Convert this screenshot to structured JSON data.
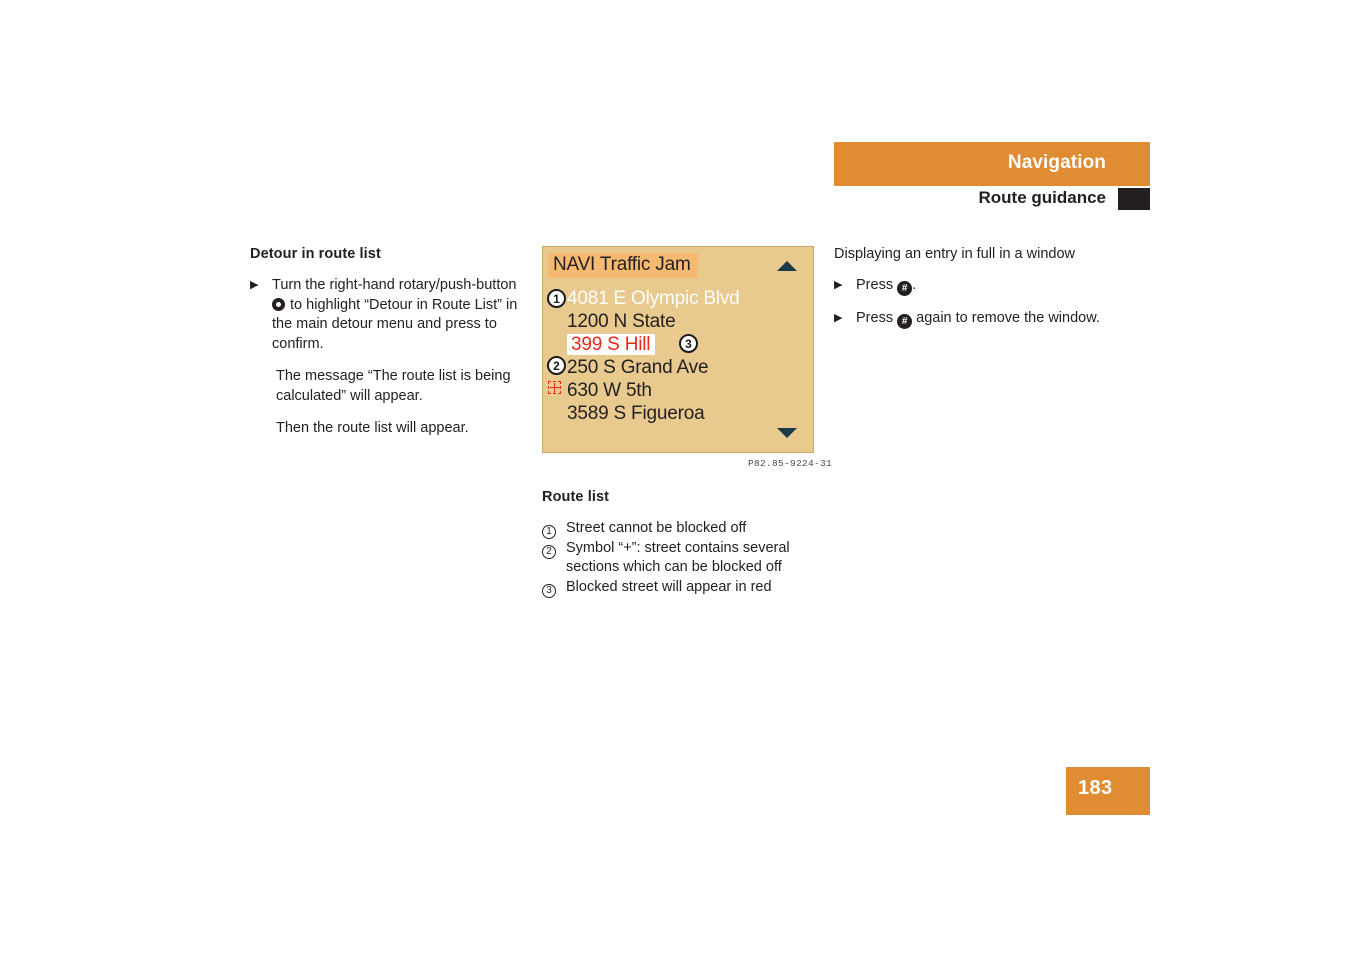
{
  "header": {
    "section": "Navigation",
    "subsection": "Route guidance"
  },
  "left_column": {
    "title": "Detour in route list",
    "bullet_1_part1": "Turn the right-hand rotary/push-button",
    "bullet_1_part2": "to highlight “Detour in Route List” in the main detour menu and press to confirm.",
    "paragraph_1": "The message “The route list is being calculated” will appear.",
    "paragraph_2": "Then the route list will appear."
  },
  "nav_display": {
    "title": "NAVI Traffic Jam",
    "scroll_up_icon": "triangle-up-icon",
    "scroll_down_icon": "triangle-down-icon",
    "rows": [
      {
        "number": "4081",
        "dir": "E",
        "street": "Olympic Blvd",
        "state": "dimmed",
        "symbol": "none"
      },
      {
        "number": "1200",
        "dir": "N",
        "street": "State",
        "state": "normal",
        "symbol": "none"
      },
      {
        "number": "399",
        "dir": "S",
        "street": "Hill",
        "state": "blocked",
        "symbol": "plus-red"
      },
      {
        "number": "250",
        "dir": "S",
        "street": "Grand Ave",
        "state": "normal",
        "symbol": "none"
      },
      {
        "number": "630",
        "dir": "W",
        "street": "5th",
        "state": "normal",
        "symbol": "none"
      },
      {
        "number": "3589",
        "dir": "S",
        "street": "Figueroa",
        "state": "normal",
        "symbol": "plus-dark"
      }
    ],
    "callouts": {
      "one": "1",
      "two": "2",
      "three": "3"
    },
    "caption": "P82.85-9224-31"
  },
  "legend": {
    "title": "Route list",
    "items": [
      {
        "num": "1",
        "text": "Street cannot be blocked off",
        "cont": ""
      },
      {
        "num": "2",
        "text": "Symbol “+”: street contains several",
        "cont": "sections which can be blocked off"
      },
      {
        "num": "3",
        "text": "Blocked street will appear in red",
        "cont": ""
      }
    ]
  },
  "right_column": {
    "title": "Displaying an entry in full in a window",
    "bullet_1_pre": "Press",
    "bullet_1_post": ".",
    "bullet_2_pre": "Press",
    "bullet_2_post": "again to remove the window.",
    "hash_glyph": "#"
  },
  "page": {
    "number": "183"
  },
  "colors": {
    "brand_orange": "#e08c33",
    "nav_background": "#e8ca8f",
    "nav_title_highlight": "#f5b971",
    "blocked_red": "#e8291a",
    "dark": "#231f20"
  }
}
